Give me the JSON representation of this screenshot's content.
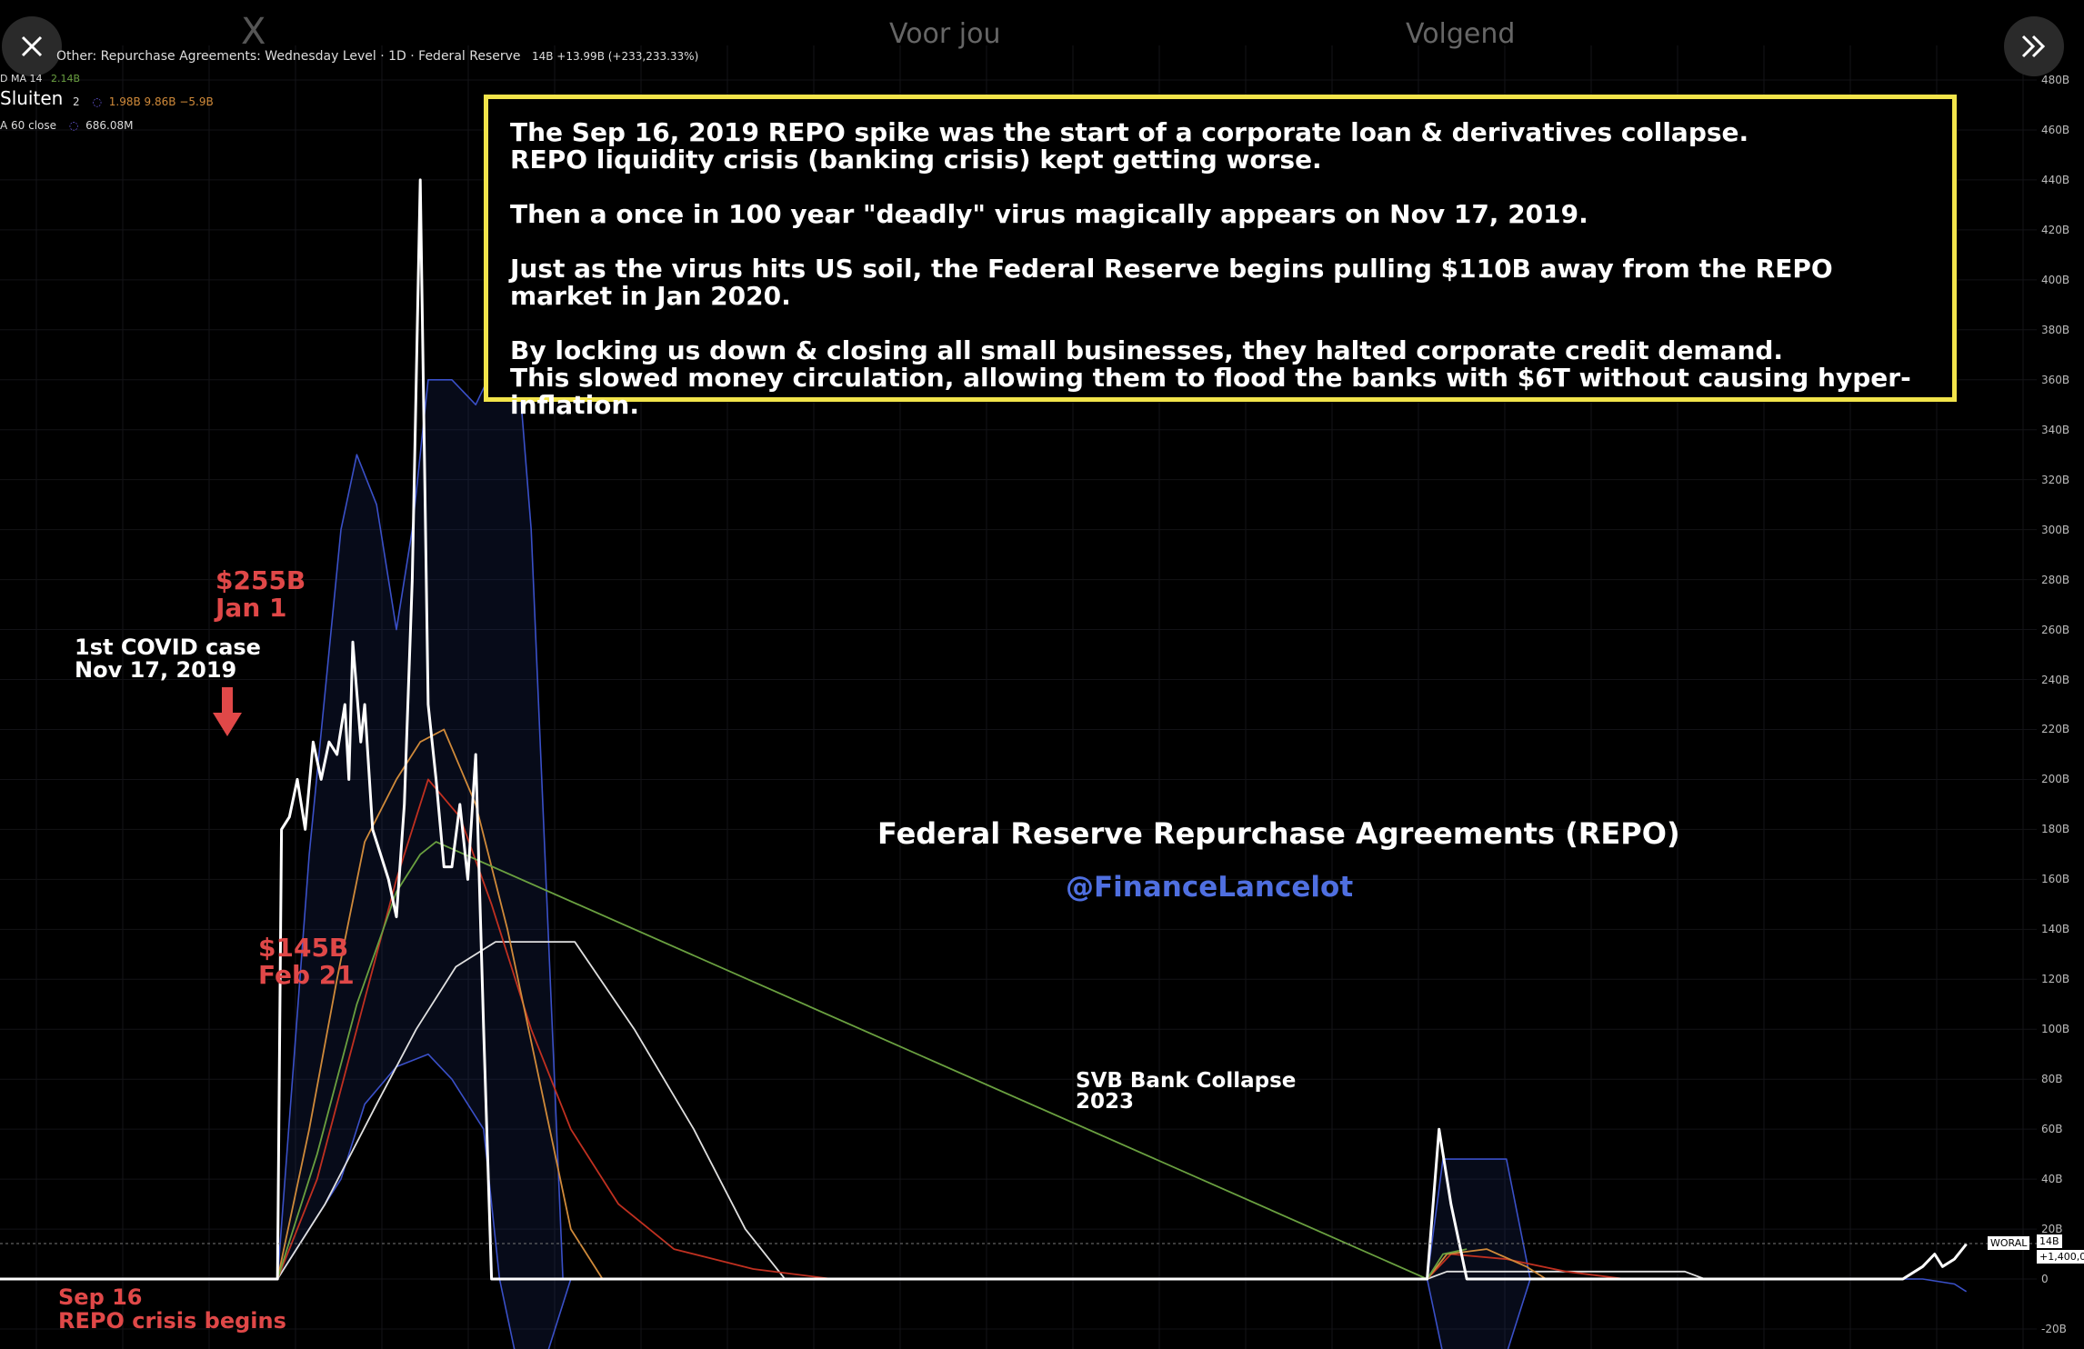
{
  "topbar": {
    "logo": "X",
    "tab_foryou": "Voor jou",
    "tab_following": "Volgend",
    "close_label": "Sluiten"
  },
  "header": {
    "series_title": "Other: Repurchase Agreements: Wednesday Level · 1D · Federal Reserve",
    "series_values": "14B +13.99B (+233,233.33%)",
    "legend_row1_label": "D MA 14",
    "legend_row1_value": "2.14B",
    "legend_row2_label": "2",
    "legend_row2_values": "1.98B  9.86B  −5.9B",
    "legend_row3_label": "A 60 close",
    "legend_row3_value": "686.08M"
  },
  "callout": {
    "para1": "The Sep 16, 2019 REPO spike was the start of a corporate loan & derivatives collapse.\nREPO liquidity crisis (banking crisis) kept getting worse.",
    "para2": "Then a once in 100 year \"deadly\" virus magically appears on Nov 17, 2019.",
    "para3": "Just as the virus hits US soil, the Federal Reserve begins pulling $110B away from the REPO market in Jan 2020.",
    "para4": "By locking us down & closing all small businesses, they halted corporate credit demand.\nThis slowed money circulation, allowing them to flood the banks with $6T without causing hyper-inflation."
  },
  "annotations": {
    "peak": "$255B\nJan 1",
    "covid": "1st COVID case\nNov 17, 2019",
    "feb": "$145B\nFeb 21",
    "sep": "Sep 16\nREPO crisis begins",
    "svb": "SVB Bank Collapse\n2023"
  },
  "chart_title": "Federal Reserve Repurchase Agreements (REPO)",
  "chart_handle": "@FinanceLancelot",
  "price_label": "WORAL",
  "price_value": "14B",
  "price_change": "+1,400,0",
  "colors": {
    "background": "#000000",
    "main_line": "#ffffff",
    "band": "#3a50c8",
    "ma_orange": "#d08a3a",
    "ma_red": "#c03020",
    "ma_green": "#6aa040",
    "ma_white": "#e0e0e0",
    "callout_border": "#f2e44a",
    "annotation_red": "#e04848",
    "handle_blue": "#4f6fe0"
  },
  "chart_data": {
    "type": "line",
    "title": "Federal Reserve Repurchase Agreements (REPO)",
    "xlabel": "",
    "ylabel": "",
    "ylim": [
      -20,
      480
    ],
    "y_ticks": [
      "480B",
      "460B",
      "440B",
      "420B",
      "400B",
      "380B",
      "360B",
      "340B",
      "320B",
      "300B",
      "280B",
      "260B",
      "240B",
      "220B",
      "200B",
      "180B",
      "160B",
      "140B",
      "120B",
      "100B",
      "80B",
      "60B",
      "40B",
      "20B",
      "0",
      "-20B"
    ],
    "x_range": [
      2019.0,
      2024.0
    ],
    "series": [
      {
        "key": "repo",
        "color": "#ffffff",
        "points": [
          [
            2019.0,
            0
          ],
          [
            2019.7,
            0
          ],
          [
            2019.71,
            180
          ],
          [
            2019.73,
            185
          ],
          [
            2019.75,
            200
          ],
          [
            2019.77,
            180
          ],
          [
            2019.79,
            215
          ],
          [
            2019.81,
            200
          ],
          [
            2019.83,
            215
          ],
          [
            2019.85,
            210
          ],
          [
            2019.87,
            230
          ],
          [
            2019.88,
            200
          ],
          [
            2019.89,
            255
          ],
          [
            2019.91,
            215
          ],
          [
            2019.92,
            230
          ],
          [
            2019.94,
            180
          ],
          [
            2019.96,
            170
          ],
          [
            2019.98,
            160
          ],
          [
            2020.0,
            145
          ],
          [
            2020.02,
            190
          ],
          [
            2020.04,
            280
          ],
          [
            2020.06,
            440
          ],
          [
            2020.08,
            230
          ],
          [
            2020.1,
            200
          ],
          [
            2020.12,
            165
          ],
          [
            2020.14,
            165
          ],
          [
            2020.16,
            190
          ],
          [
            2020.18,
            160
          ],
          [
            2020.2,
            210
          ],
          [
            2020.22,
            100
          ],
          [
            2020.24,
            0
          ],
          [
            2021.0,
            0
          ],
          [
            2022.6,
            0
          ],
          [
            2022.63,
            60
          ],
          [
            2022.66,
            30
          ],
          [
            2022.7,
            0
          ],
          [
            2023.8,
            0
          ],
          [
            2023.85,
            5
          ],
          [
            2023.88,
            10
          ],
          [
            2023.9,
            5
          ],
          [
            2023.93,
            8
          ],
          [
            2023.96,
            14
          ]
        ]
      },
      {
        "key": "ma_orange",
        "color": "#d08a3a",
        "points": [
          [
            2019.0,
            0
          ],
          [
            2019.7,
            0
          ],
          [
            2019.78,
            60
          ],
          [
            2019.85,
            120
          ],
          [
            2019.92,
            175
          ],
          [
            2020.0,
            200
          ],
          [
            2020.06,
            215
          ],
          [
            2020.12,
            220
          ],
          [
            2020.2,
            190
          ],
          [
            2020.28,
            140
          ],
          [
            2020.36,
            80
          ],
          [
            2020.44,
            20
          ],
          [
            2020.52,
            0
          ],
          [
            2022.6,
            0
          ],
          [
            2022.65,
            10
          ],
          [
            2022.75,
            12
          ],
          [
            2022.85,
            5
          ],
          [
            2022.9,
            0
          ]
        ]
      },
      {
        "key": "ma_red",
        "color": "#c03020",
        "points": [
          [
            2019.0,
            0
          ],
          [
            2019.7,
            0
          ],
          [
            2019.8,
            40
          ],
          [
            2019.9,
            100
          ],
          [
            2020.0,
            160
          ],
          [
            2020.08,
            200
          ],
          [
            2020.16,
            185
          ],
          [
            2020.24,
            150
          ],
          [
            2020.34,
            100
          ],
          [
            2020.44,
            60
          ],
          [
            2020.56,
            30
          ],
          [
            2020.7,
            12
          ],
          [
            2020.9,
            4
          ],
          [
            2021.1,
            0
          ],
          [
            2022.6,
            0
          ],
          [
            2022.66,
            10
          ],
          [
            2022.8,
            8
          ],
          [
            2022.95,
            3
          ],
          [
            2023.1,
            0
          ]
        ]
      },
      {
        "key": "ma_green",
        "color": "#6aa040",
        "points": [
          [
            2019.0,
            0
          ],
          [
            2019.7,
            0
          ],
          [
            2019.8,
            50
          ],
          [
            2019.9,
            110
          ],
          [
            2020.0,
            155
          ],
          [
            2020.06,
            170
          ],
          [
            2020.1,
            175
          ],
          [
            2022.6,
            0
          ],
          [
            2022.64,
            10
          ],
          [
            2022.7,
            12
          ]
        ]
      },
      {
        "key": "ma_white",
        "color": "#e0e0e0",
        "points": [
          [
            2019.0,
            0
          ],
          [
            2019.7,
            0
          ],
          [
            2019.82,
            30
          ],
          [
            2019.95,
            70
          ],
          [
            2020.05,
            100
          ],
          [
            2020.15,
            125
          ],
          [
            2020.25,
            135
          ],
          [
            2020.45,
            135
          ],
          [
            2020.6,
            100
          ],
          [
            2020.75,
            60
          ],
          [
            2020.88,
            20
          ],
          [
            2020.98,
            0
          ],
          [
            2022.6,
            0
          ],
          [
            2022.65,
            3
          ],
          [
            2023.25,
            3
          ],
          [
            2023.3,
            0
          ]
        ]
      },
      {
        "key": "band_upper",
        "color": "#3a50c8",
        "points": [
          [
            2019.0,
            0
          ],
          [
            2019.7,
            0
          ],
          [
            2019.78,
            170
          ],
          [
            2019.86,
            300
          ],
          [
            2019.9,
            330
          ],
          [
            2019.95,
            310
          ],
          [
            2020.0,
            260
          ],
          [
            2020.04,
            300
          ],
          [
            2020.08,
            360
          ],
          [
            2020.14,
            360
          ],
          [
            2020.2,
            350
          ],
          [
            2020.26,
            370
          ],
          [
            2020.3,
            380
          ],
          [
            2020.34,
            300
          ],
          [
            2020.42,
            0
          ],
          [
            2022.6,
            0
          ],
          [
            2022.64,
            48
          ],
          [
            2022.8,
            48
          ],
          [
            2022.86,
            0
          ]
        ]
      },
      {
        "key": "band_lower",
        "color": "#3a50c8",
        "points": [
          [
            2019.0,
            0
          ],
          [
            2019.7,
            0
          ],
          [
            2019.78,
            20
          ],
          [
            2019.86,
            40
          ],
          [
            2019.92,
            70
          ],
          [
            2020.0,
            85
          ],
          [
            2020.08,
            90
          ],
          [
            2020.14,
            80
          ],
          [
            2020.22,
            60
          ],
          [
            2020.26,
            0
          ],
          [
            2020.3,
            -30
          ],
          [
            2020.38,
            -30
          ],
          [
            2020.44,
            0
          ],
          [
            2022.6,
            0
          ],
          [
            2022.64,
            -30
          ],
          [
            2022.8,
            -30
          ],
          [
            2022.86,
            0
          ],
          [
            2023.85,
            0
          ],
          [
            2023.93,
            -2
          ],
          [
            2023.96,
            -5
          ]
        ]
      }
    ]
  }
}
